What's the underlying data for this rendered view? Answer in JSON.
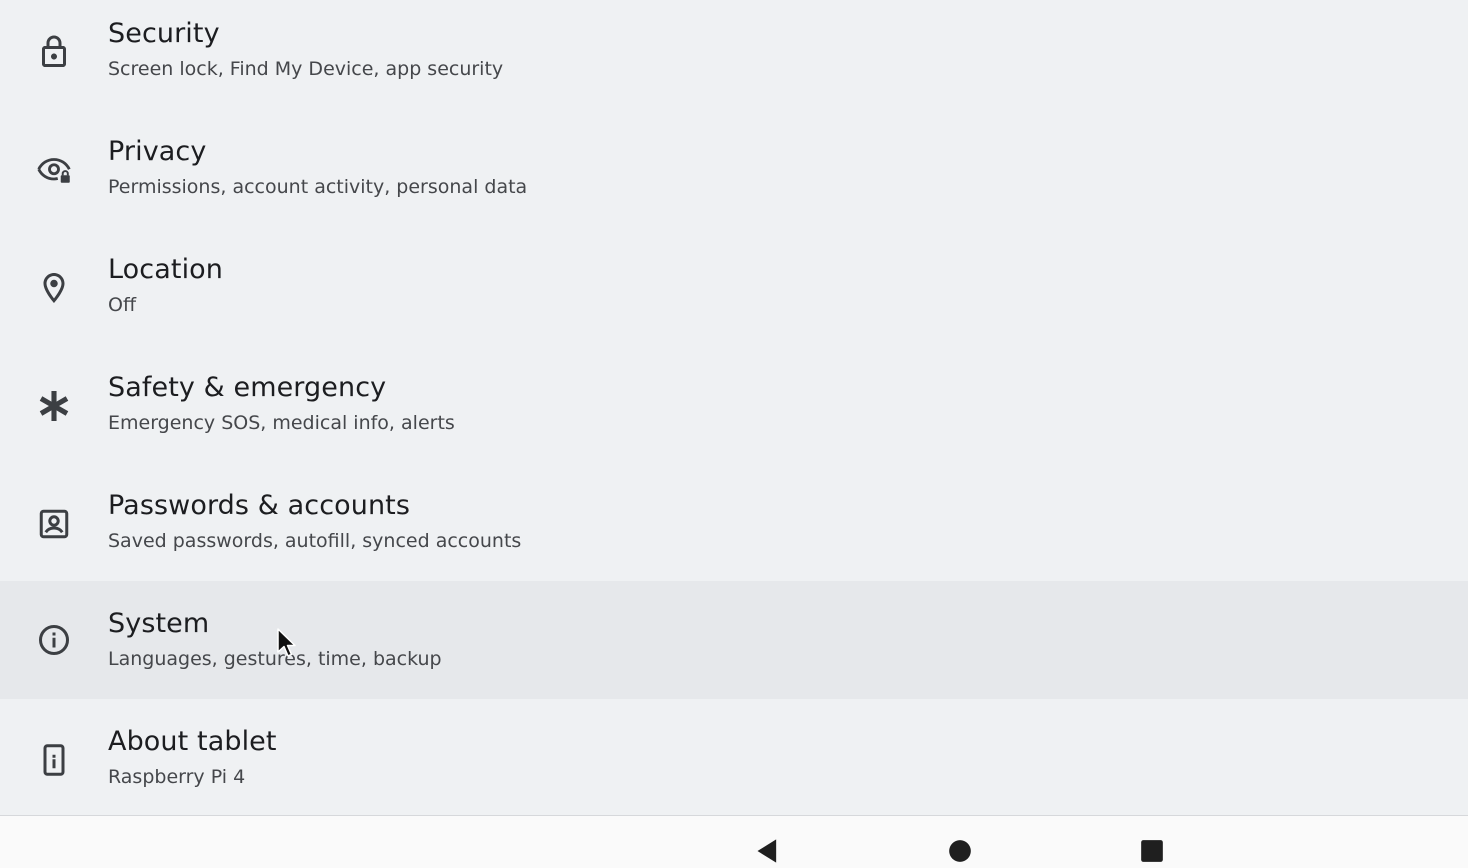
{
  "settings": {
    "items": [
      {
        "icon": "lock-icon",
        "title": "Security",
        "subtitle": "Screen lock, Find My Device, app security"
      },
      {
        "icon": "eye-lock-icon",
        "title": "Privacy",
        "subtitle": "Permissions, account activity, personal data"
      },
      {
        "icon": "location-pin-icon",
        "title": "Location",
        "subtitle": "Off"
      },
      {
        "icon": "asterisk-icon",
        "title": "Safety & emergency",
        "subtitle": "Emergency SOS, medical info, alerts"
      },
      {
        "icon": "account-box-icon",
        "title": "Passwords & accounts",
        "subtitle": "Saved passwords, autofill, synced accounts"
      },
      {
        "icon": "info-icon",
        "title": "System",
        "subtitle": "Languages, gestures, time, backup"
      },
      {
        "icon": "tablet-icon",
        "title": "About tablet",
        "subtitle": "Raspberry Pi 4"
      }
    ],
    "selected": "System"
  },
  "navigation_bar": {
    "buttons": [
      "back-icon",
      "home-icon",
      "recents-icon"
    ]
  },
  "colors": {
    "background": "#eff1f3",
    "selected_row": "#e6e8eb",
    "title_text": "#1c1d20",
    "subtitle_text": "#45474b",
    "icon": "#3c3f43",
    "nav_bar": "#fafafa"
  }
}
